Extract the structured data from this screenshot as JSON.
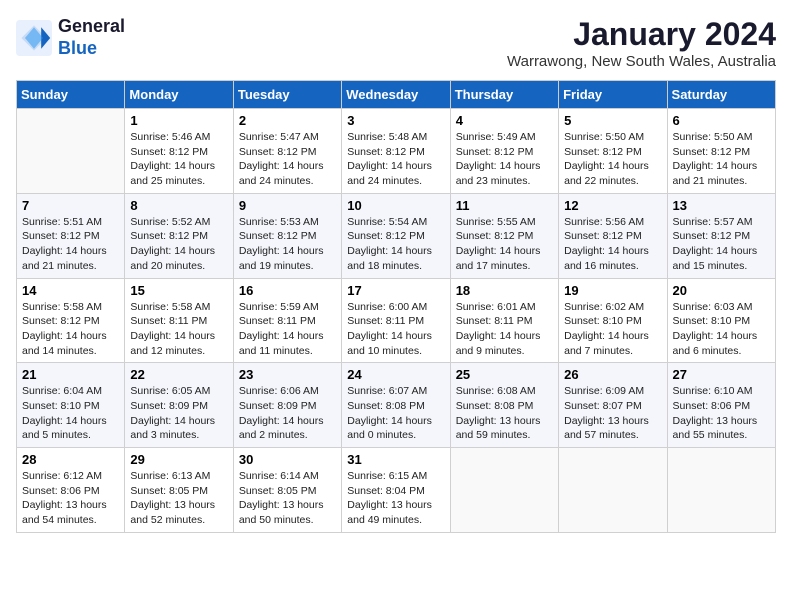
{
  "logo": {
    "line1": "General",
    "line2": "Blue"
  },
  "title": "January 2024",
  "location": "Warrawong, New South Wales, Australia",
  "days_of_week": [
    "Sunday",
    "Monday",
    "Tuesday",
    "Wednesday",
    "Thursday",
    "Friday",
    "Saturday"
  ],
  "weeks": [
    [
      {
        "day": "",
        "sunrise": "",
        "sunset": "",
        "daylight": ""
      },
      {
        "day": "1",
        "sunrise": "5:46 AM",
        "sunset": "8:12 PM",
        "daylight": "14 hours and 25 minutes."
      },
      {
        "day": "2",
        "sunrise": "5:47 AM",
        "sunset": "8:12 PM",
        "daylight": "14 hours and 24 minutes."
      },
      {
        "day": "3",
        "sunrise": "5:48 AM",
        "sunset": "8:12 PM",
        "daylight": "14 hours and 24 minutes."
      },
      {
        "day": "4",
        "sunrise": "5:49 AM",
        "sunset": "8:12 PM",
        "daylight": "14 hours and 23 minutes."
      },
      {
        "day": "5",
        "sunrise": "5:50 AM",
        "sunset": "8:12 PM",
        "daylight": "14 hours and 22 minutes."
      },
      {
        "day": "6",
        "sunrise": "5:50 AM",
        "sunset": "8:12 PM",
        "daylight": "14 hours and 21 minutes."
      }
    ],
    [
      {
        "day": "7",
        "sunrise": "5:51 AM",
        "sunset": "8:12 PM",
        "daylight": "14 hours and 21 minutes."
      },
      {
        "day": "8",
        "sunrise": "5:52 AM",
        "sunset": "8:12 PM",
        "daylight": "14 hours and 20 minutes."
      },
      {
        "day": "9",
        "sunrise": "5:53 AM",
        "sunset": "8:12 PM",
        "daylight": "14 hours and 19 minutes."
      },
      {
        "day": "10",
        "sunrise": "5:54 AM",
        "sunset": "8:12 PM",
        "daylight": "14 hours and 18 minutes."
      },
      {
        "day": "11",
        "sunrise": "5:55 AM",
        "sunset": "8:12 PM",
        "daylight": "14 hours and 17 minutes."
      },
      {
        "day": "12",
        "sunrise": "5:56 AM",
        "sunset": "8:12 PM",
        "daylight": "14 hours and 16 minutes."
      },
      {
        "day": "13",
        "sunrise": "5:57 AM",
        "sunset": "8:12 PM",
        "daylight": "14 hours and 15 minutes."
      }
    ],
    [
      {
        "day": "14",
        "sunrise": "5:58 AM",
        "sunset": "8:12 PM",
        "daylight": "14 hours and 14 minutes."
      },
      {
        "day": "15",
        "sunrise": "5:58 AM",
        "sunset": "8:11 PM",
        "daylight": "14 hours and 12 minutes."
      },
      {
        "day": "16",
        "sunrise": "5:59 AM",
        "sunset": "8:11 PM",
        "daylight": "14 hours and 11 minutes."
      },
      {
        "day": "17",
        "sunrise": "6:00 AM",
        "sunset": "8:11 PM",
        "daylight": "14 hours and 10 minutes."
      },
      {
        "day": "18",
        "sunrise": "6:01 AM",
        "sunset": "8:11 PM",
        "daylight": "14 hours and 9 minutes."
      },
      {
        "day": "19",
        "sunrise": "6:02 AM",
        "sunset": "8:10 PM",
        "daylight": "14 hours and 7 minutes."
      },
      {
        "day": "20",
        "sunrise": "6:03 AM",
        "sunset": "8:10 PM",
        "daylight": "14 hours and 6 minutes."
      }
    ],
    [
      {
        "day": "21",
        "sunrise": "6:04 AM",
        "sunset": "8:10 PM",
        "daylight": "14 hours and 5 minutes."
      },
      {
        "day": "22",
        "sunrise": "6:05 AM",
        "sunset": "8:09 PM",
        "daylight": "14 hours and 3 minutes."
      },
      {
        "day": "23",
        "sunrise": "6:06 AM",
        "sunset": "8:09 PM",
        "daylight": "14 hours and 2 minutes."
      },
      {
        "day": "24",
        "sunrise": "6:07 AM",
        "sunset": "8:08 PM",
        "daylight": "14 hours and 0 minutes."
      },
      {
        "day": "25",
        "sunrise": "6:08 AM",
        "sunset": "8:08 PM",
        "daylight": "13 hours and 59 minutes."
      },
      {
        "day": "26",
        "sunrise": "6:09 AM",
        "sunset": "8:07 PM",
        "daylight": "13 hours and 57 minutes."
      },
      {
        "day": "27",
        "sunrise": "6:10 AM",
        "sunset": "8:06 PM",
        "daylight": "13 hours and 55 minutes."
      }
    ],
    [
      {
        "day": "28",
        "sunrise": "6:12 AM",
        "sunset": "8:06 PM",
        "daylight": "13 hours and 54 minutes."
      },
      {
        "day": "29",
        "sunrise": "6:13 AM",
        "sunset": "8:05 PM",
        "daylight": "13 hours and 52 minutes."
      },
      {
        "day": "30",
        "sunrise": "6:14 AM",
        "sunset": "8:05 PM",
        "daylight": "13 hours and 50 minutes."
      },
      {
        "day": "31",
        "sunrise": "6:15 AM",
        "sunset": "8:04 PM",
        "daylight": "13 hours and 49 minutes."
      },
      {
        "day": "",
        "sunrise": "",
        "sunset": "",
        "daylight": ""
      },
      {
        "day": "",
        "sunrise": "",
        "sunset": "",
        "daylight": ""
      },
      {
        "day": "",
        "sunrise": "",
        "sunset": "",
        "daylight": ""
      }
    ]
  ]
}
